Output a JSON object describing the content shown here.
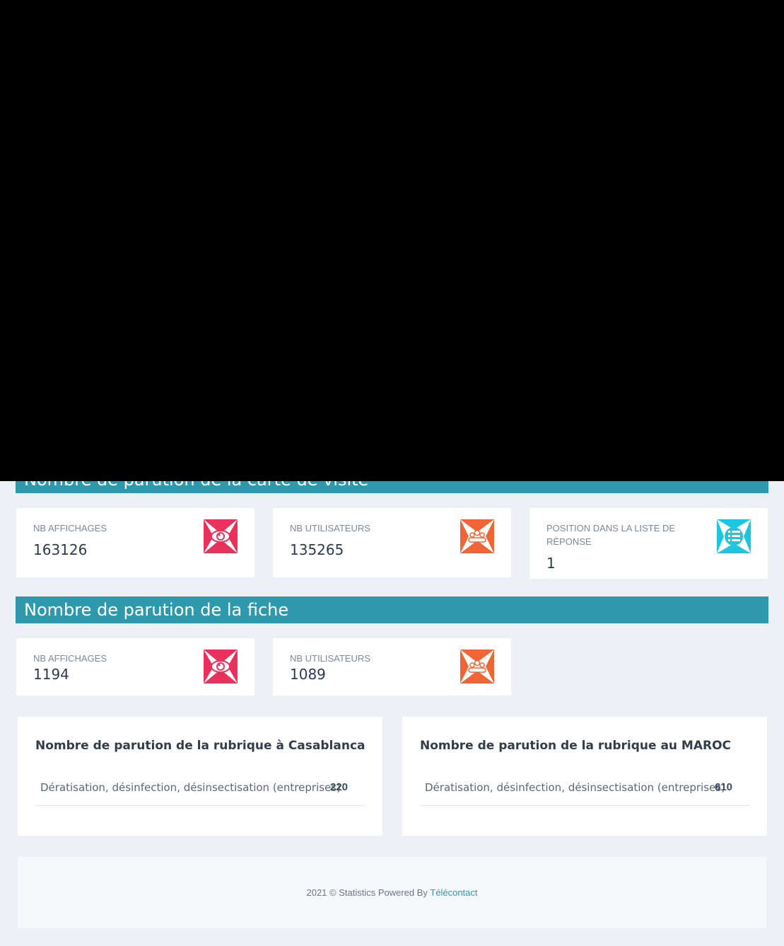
{
  "sections": {
    "carte": {
      "title": "Nombre de parution de la carte de visite",
      "stats": [
        {
          "label": "NB AFFICHAGES",
          "value": "163126",
          "icon": "eye-icon"
        },
        {
          "label": "NB UTILISATEURS",
          "value": "135265",
          "icon": "users-icon"
        },
        {
          "label": "POSITION DANS LA LISTE DE RÉPONSE",
          "value": "1",
          "icon": "list-icon"
        }
      ]
    },
    "fiche": {
      "title": "Nombre de parution de la fiche",
      "stats": [
        {
          "label": "NB AFFICHAGES",
          "value": "1194",
          "icon": "eye-icon"
        },
        {
          "label": "NB UTILISATEURS",
          "value": "1089",
          "icon": "users-icon"
        }
      ]
    }
  },
  "rubriques": [
    {
      "title": "Nombre de parution de la rubrique à Casablanca",
      "rows": [
        {
          "name": "Dératisation, désinfection, désinsectisation (entreprises)",
          "count": "220"
        }
      ]
    },
    {
      "title": "Nombre de parution de la rubrique au MAROC",
      "rows": [
        {
          "name": "Dératisation, désinfection, désinsectisation (entreprises)",
          "count": "610"
        }
      ]
    }
  ],
  "footer": {
    "text": "2021 © Statistics Powered By",
    "link": "Télécontact"
  },
  "colors": {
    "header": "#2e98ac",
    "eye": "#e8325c",
    "users": "#f06436",
    "list": "#1cc6df"
  }
}
